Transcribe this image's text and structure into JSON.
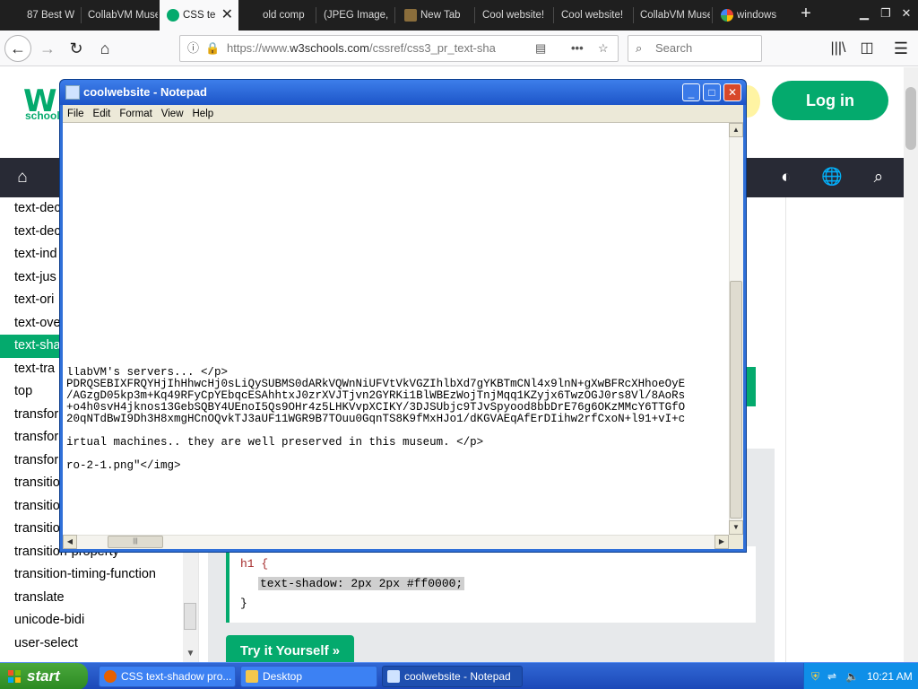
{
  "browser": {
    "tabs": [
      {
        "label": "87 Best W",
        "active": false
      },
      {
        "label": "CollabVM Muse",
        "active": false
      },
      {
        "label": "CSS te",
        "active": true
      },
      {
        "label": "old comp",
        "active": false
      },
      {
        "label": "(JPEG Image,",
        "active": false
      },
      {
        "label": "New Tab",
        "active": false
      },
      {
        "label": "Cool website!",
        "active": false
      },
      {
        "label": "Cool website!",
        "active": false
      },
      {
        "label": "CollabVM Muse",
        "active": false
      },
      {
        "label": "windows",
        "active": false
      }
    ],
    "new_tab_icon": "plus-icon",
    "url_prefix": "https://www.",
    "url_domain": "w3schools.com",
    "url_path": "/cssref/css3_pr_text-sha",
    "search_placeholder": "Search"
  },
  "w3": {
    "logo_text": "schools",
    "login_label": "Log in",
    "menu_items": [
      {
        "label": "text-dec",
        "selected": false
      },
      {
        "label": "text-dec",
        "selected": false
      },
      {
        "label": "text-ind",
        "selected": false
      },
      {
        "label": "text-jus",
        "selected": false
      },
      {
        "label": "text-ori",
        "selected": false
      },
      {
        "label": "text-ove",
        "selected": false
      },
      {
        "label": "text-sha",
        "selected": true
      },
      {
        "label": "text-tra",
        "selected": false
      },
      {
        "label": "top",
        "selected": false
      },
      {
        "label": "transfor",
        "selected": false
      },
      {
        "label": "transfor",
        "selected": false
      },
      {
        "label": "transfor",
        "selected": false
      },
      {
        "label": "transitio",
        "selected": false
      },
      {
        "label": "transitio",
        "selected": false
      },
      {
        "label": "transitio",
        "selected": false
      },
      {
        "label": "transition-property",
        "selected": false
      },
      {
        "label": "transition-timing-function",
        "selected": false
      },
      {
        "label": "translate",
        "selected": false
      },
      {
        "label": "unicode-bidi",
        "selected": false
      },
      {
        "label": "user-select",
        "selected": false
      }
    ],
    "code": {
      "line1": "h1 {",
      "line2": "text-shadow: 2px 2px #ff0000;",
      "line3": "}"
    },
    "tryit_label": "Try it Yourself »"
  },
  "notepad": {
    "title": "coolwebsite - Notepad",
    "menu": [
      "File",
      "Edit",
      "Format",
      "View",
      "Help"
    ],
    "lines": [
      "llabVM's servers... </p>",
      "PDRQSEBIXFRQYHjIhHhwcHj0sLiQySUBMS0dARkVQWnNiUFVtVkVGZIhlbXd7gYKBTmCNl4x9lnN+gXwBFRcXHhoeOyE",
      "/AGzgD05kp3m+Kq49RFyCpYEbqcESAhhtxJ0zrXVJTjvn2GYRKi1BlWBEzWojTnjMqq1KZyjx6TwzOGJ0rs8Vl/8AoRs",
      "+o4h0svH4jknos13GebSQBY4UEnoI5Qs9OHr4z5LHKVvpXCIKY/3DJSUbjc9TJvSpyood8bbDrE76g6OKzMMcY6TTGfO",
      "20qNTdBwI9Dh3H8xmgHCnOQvkTJ3aUF11WGR9B7TOuu0GqnTS8K9fMxHJo1/dKGVAEqAfErDIihw2rfCxoN+l91+vI+c",
      "",
      "irtual machines.. they are well preserved in this museum. </p>",
      "",
      "ro-2-1.png\"</img>"
    ]
  },
  "taskbar": {
    "start_label": "start",
    "items": [
      {
        "label": "CSS text-shadow pro...",
        "active": false
      },
      {
        "label": "Desktop",
        "active": false
      },
      {
        "label": "coolwebsite - Notepad",
        "active": true
      }
    ],
    "clock": "10:21 AM"
  },
  "colors": {
    "w3_green": "#04aa6d",
    "w3_dark_nav": "#282a35",
    "xp_blue": "#2f6fd8",
    "xp_start_green": "#3a9a2e"
  }
}
